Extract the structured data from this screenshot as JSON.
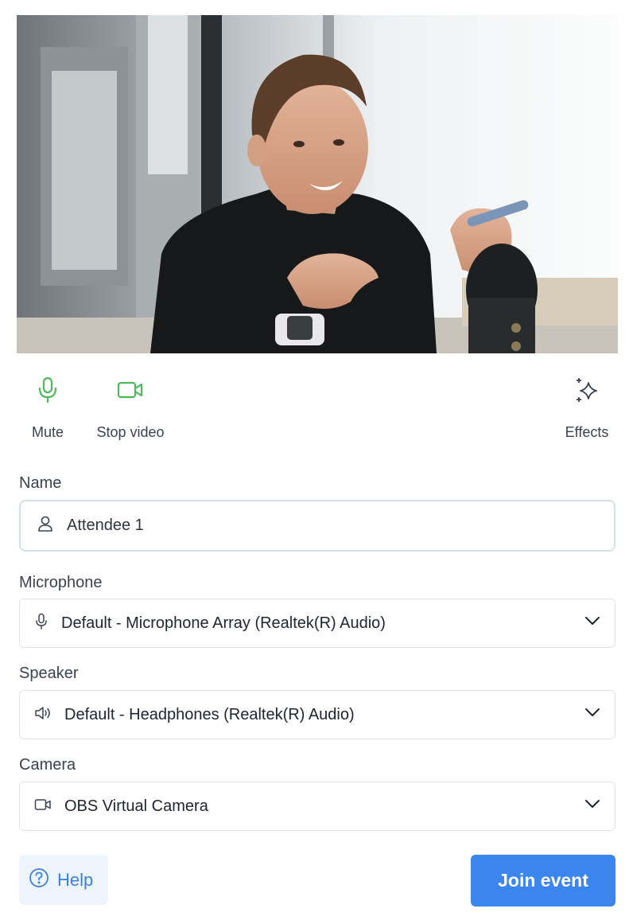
{
  "controls": {
    "mute_label": "Mute",
    "stop_video_label": "Stop video",
    "effects_label": "Effects",
    "active_color": "#4fb85a"
  },
  "form": {
    "name": {
      "label": "Name",
      "value": "Attendee 1",
      "icon": "user-icon"
    },
    "microphone": {
      "label": "Microphone",
      "value": "Default - Microphone Array (Realtek(R) Audio)",
      "icon": "microphone-icon"
    },
    "speaker": {
      "label": "Speaker",
      "value": "Default - Headphones (Realtek(R) Audio)",
      "icon": "speaker-icon"
    },
    "camera": {
      "label": "Camera",
      "value": "OBS Virtual Camera",
      "icon": "camera-icon"
    }
  },
  "footer": {
    "help_label": "Help",
    "join_label": "Join event",
    "primary_color": "#3b86ee"
  }
}
